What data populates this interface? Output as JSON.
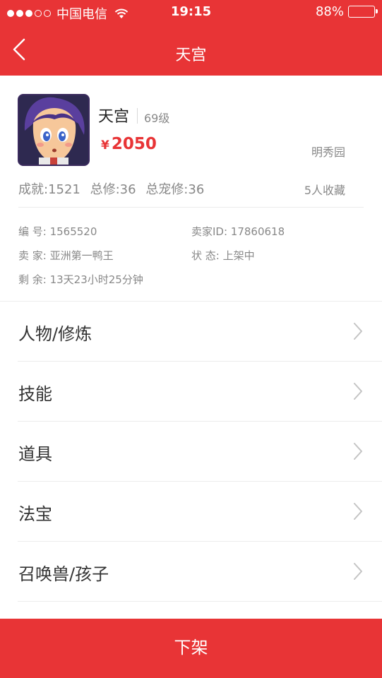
{
  "status_bar": {
    "carrier": "中国电信",
    "time": "19:15",
    "battery": "88%",
    "battery_level": 0.88
  },
  "nav": {
    "title": "天宫"
  },
  "character": {
    "name": "天宫",
    "level": "69级",
    "price_symbol": "¥",
    "price": "2050",
    "server": "明秀园",
    "stats": [
      "成就:1521",
      "总修:36",
      "总宠修:36"
    ],
    "favorites": "5人收藏"
  },
  "details": {
    "serial": "编  号: 1565520",
    "seller_id": "卖家ID: 17860618",
    "seller": "卖  家: 亚洲第一鸭王",
    "state": "状  态: 上架中",
    "remaining": "剩  余: 13天23小时25分钟"
  },
  "menu": [
    {
      "label": "人物/修炼"
    },
    {
      "label": "技能"
    },
    {
      "label": "道具"
    },
    {
      "label": "法宝"
    },
    {
      "label": "召唤兽/孩子"
    }
  ],
  "bottom_button": {
    "label": "下架"
  },
  "colors": {
    "brand": "#e83436",
    "text": "#333333",
    "muted": "#888888"
  }
}
